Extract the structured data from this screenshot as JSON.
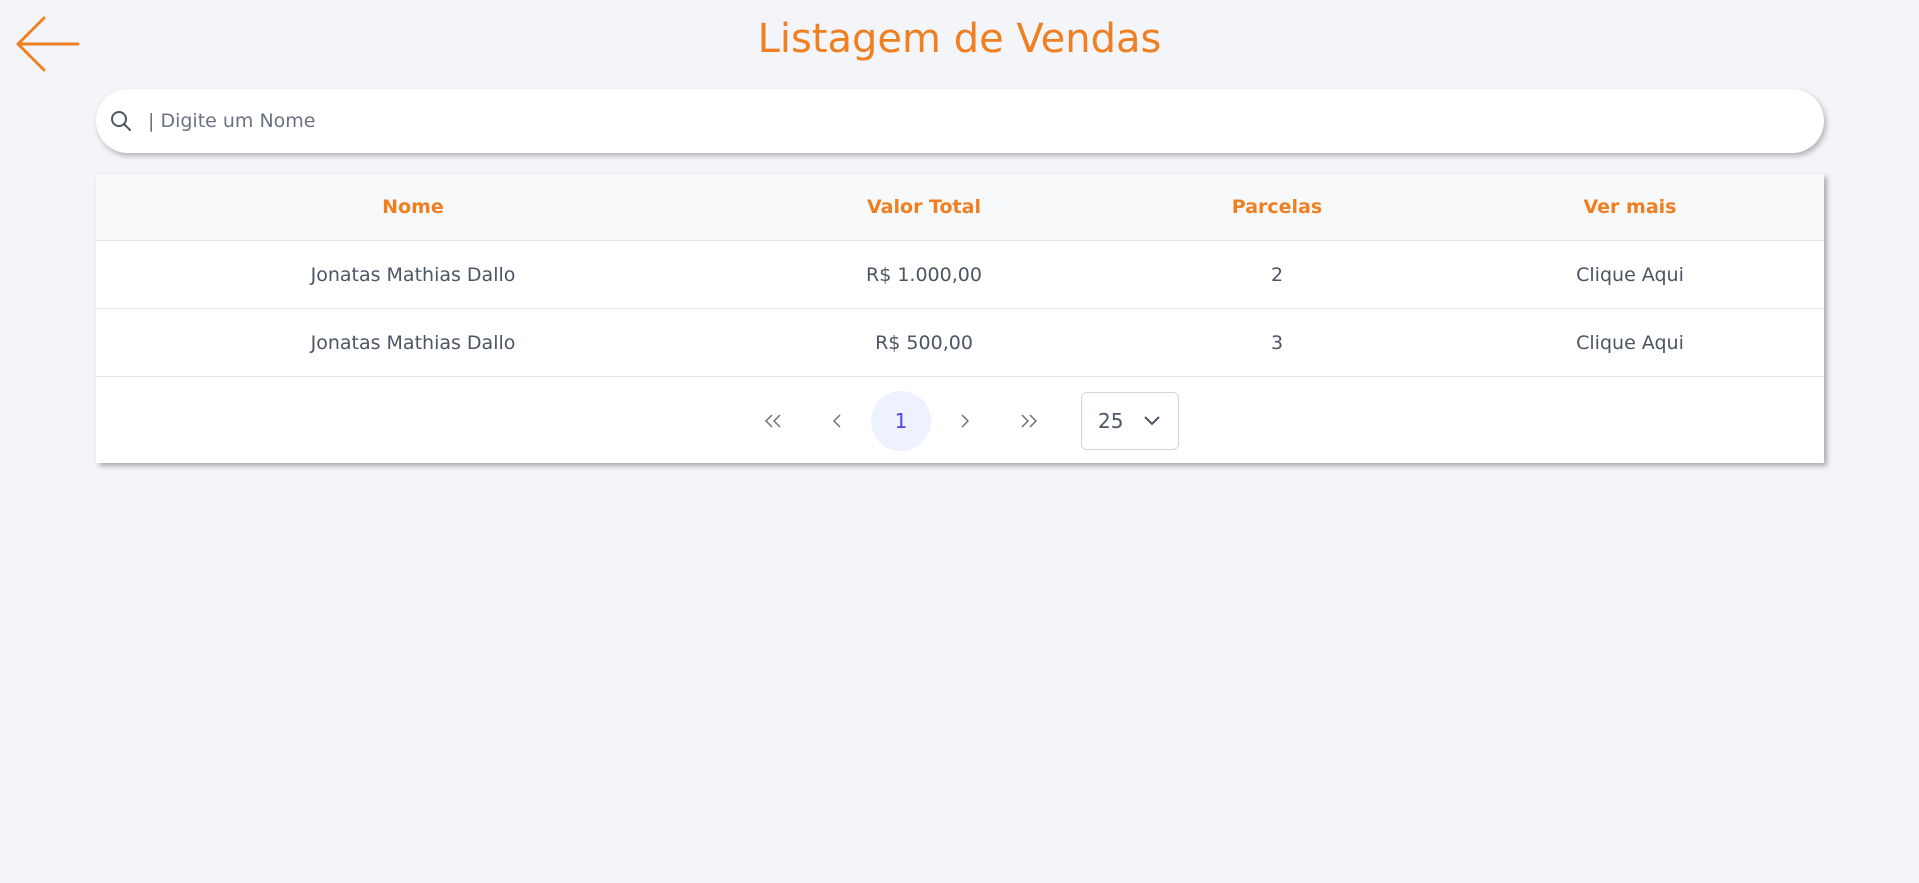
{
  "header": {
    "title": "Listagem de Vendas",
    "back_icon": "arrow-left-icon"
  },
  "search": {
    "placeholder": "| Digite um Nome",
    "value": "",
    "icon": "search-icon"
  },
  "table": {
    "columns": [
      "Nome",
      "Valor Total",
      "Parcelas",
      "Ver mais"
    ],
    "rows": [
      {
        "nome": "Jonatas Mathias Dallo",
        "valor_total": "R$ 1.000,00",
        "parcelas": "2",
        "ver_mais": "Clique Aqui"
      },
      {
        "nome": "Jonatas Mathias Dallo",
        "valor_total": "R$ 500,00",
        "parcelas": "3",
        "ver_mais": "Clique Aqui"
      }
    ]
  },
  "paginator": {
    "current_page": "1",
    "rows_per_page": "25"
  },
  "colors": {
    "accent": "#f07f21",
    "background": "#f4f5f9",
    "active_page_bg": "#eef2ff",
    "active_page_text": "#4f46e5"
  }
}
